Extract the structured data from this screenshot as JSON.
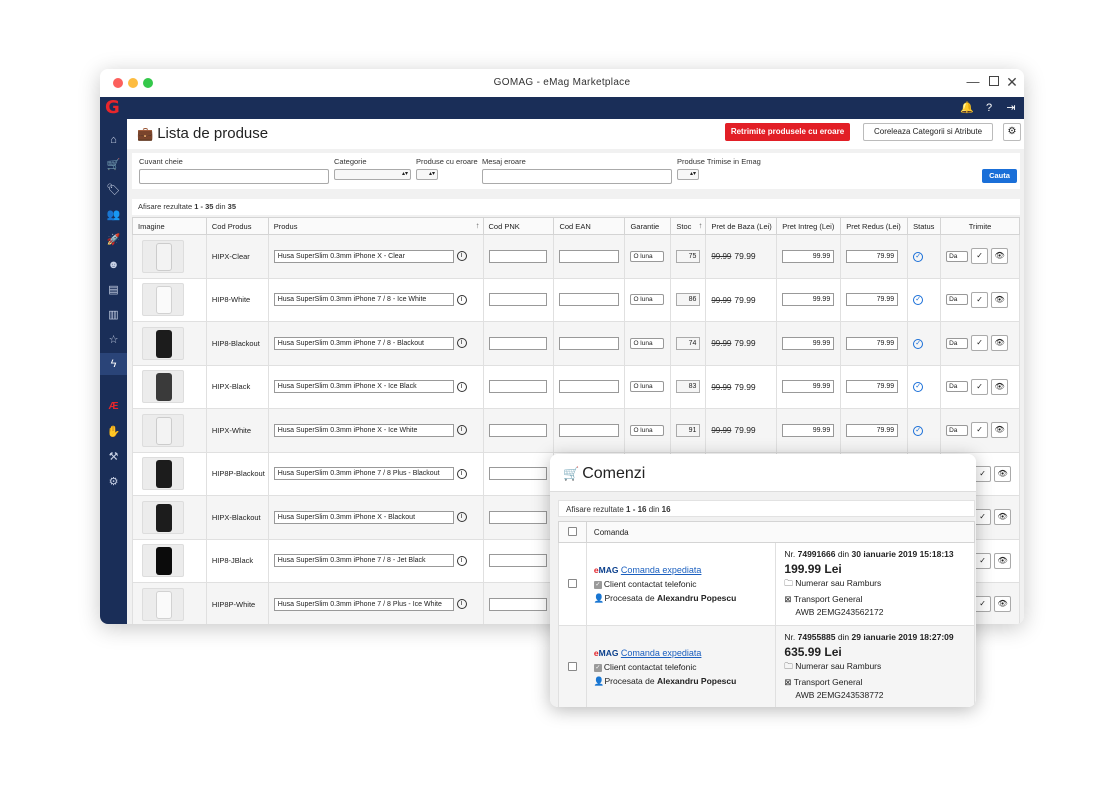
{
  "window": {
    "title": "GOMAG - eMag Marketplace"
  },
  "header": {
    "title": "Lista de produse",
    "resend_button": "Retrimite produsele cu eroare",
    "correlate_button": "Coreleaza Categorii si Atribute"
  },
  "filters": {
    "keyword_label": "Cuvant cheie",
    "category_label": "Categorie",
    "error_products_label": "Produse cu eroare",
    "error_message_label": "Mesaj eroare",
    "sent_products_label": "Produse Trimise in Emag",
    "search_button": "Cauta"
  },
  "results": {
    "prefix": "Afisare rezultate ",
    "range": "1 - 35",
    "mid": " din ",
    "total": "35"
  },
  "columns": [
    "Imagine",
    "Cod Produs",
    "Produs",
    "Cod PNK",
    "Cod EAN",
    "Garantie",
    "Stoc",
    "Pret de Baza (Lei)",
    "Pret Intreg (Lei)",
    "Pret Redus (Lei)",
    "Status",
    "Trimite"
  ],
  "products": [
    {
      "code": "HIPX-Clear",
      "name": "Husa SuperSlim 0.3mm iPhone X - Clear",
      "warranty": "O luna",
      "stock": "75",
      "base_old": "99.99",
      "base_new": "79.99",
      "full": "99.99",
      "reduced": "79.99",
      "send": "Da"
    },
    {
      "code": "HIP8-White",
      "name": "Husa SuperSlim 0.3mm iPhone 7 / 8 - Ice White",
      "warranty": "O luna",
      "stock": "86",
      "base_old": "99.99",
      "base_new": "79.99",
      "full": "99.99",
      "reduced": "79.99",
      "send": "Da"
    },
    {
      "code": "HIP8-Blackout",
      "name": "Husa SuperSlim 0.3mm iPhone 7 / 8 - Blackout",
      "warranty": "O luna",
      "stock": "74",
      "base_old": "99.99",
      "base_new": "79.99",
      "full": "99.99",
      "reduced": "79.99",
      "send": "Da"
    },
    {
      "code": "HIPX-Black",
      "name": "Husa SuperSlim 0.3mm iPhone X - Ice Black",
      "warranty": "O luna",
      "stock": "83",
      "base_old": "99.99",
      "base_new": "79.99",
      "full": "99.99",
      "reduced": "79.99",
      "send": "Da"
    },
    {
      "code": "HIPX-White",
      "name": "Husa SuperSlim 0.3mm iPhone X - Ice White",
      "warranty": "O luna",
      "stock": "91",
      "base_old": "99.99",
      "base_new": "79.99",
      "full": "99.99",
      "reduced": "79.99",
      "send": "Da"
    },
    {
      "code": "HIP8P-Blackout",
      "name": "Husa SuperSlim 0.3mm iPhone 7 / 8 Plus - Blackout"
    },
    {
      "code": "HIPX-Blackout",
      "name": "Husa SuperSlim 0.3mm iPhone X - Blackout"
    },
    {
      "code": "HIP8-JBlack",
      "name": "Husa SuperSlim 0.3mm iPhone 7 / 8 - Jet Black"
    },
    {
      "code": "HIP8P-White",
      "name": "Husa SuperSlim 0.3mm iPhone 7 / 8 Plus - Ice White"
    }
  ],
  "orders": {
    "title": "Comenzi",
    "results": {
      "prefix": "Afisare rezultate ",
      "range": "1 - 16",
      "mid": " din ",
      "total": "16"
    },
    "column": "Comanda",
    "items": [
      {
        "brand": "eMAG",
        "status": "Comanda expediata",
        "contact": "Client contactat telefonic",
        "processed_prefix": "Procesata de ",
        "processed_by": "Alexandru Popescu",
        "nr_prefix": "Nr. ",
        "nr": "74991666",
        "date_prefix": " din ",
        "date": "30 ianuarie 2019 15:18:13",
        "price": "199.99 Lei",
        "payment": "Numerar sau Ramburs",
        "transport": "Transport General",
        "awb": "AWB 2EMG243562172"
      },
      {
        "brand": "eMAG",
        "status": "Comanda expediata",
        "contact": "Client contactat telefonic",
        "processed_prefix": "Procesata de ",
        "processed_by": "Alexandru Popescu",
        "nr_prefix": "Nr. ",
        "nr": "74955885",
        "date_prefix": " din ",
        "date": "29 ianuarie 2019 18:27:09",
        "price": "635.99 Lei",
        "payment": "Numerar sau Ramburs",
        "transport": "Transport General",
        "awb": "AWB 2EMG243538772"
      }
    ]
  }
}
